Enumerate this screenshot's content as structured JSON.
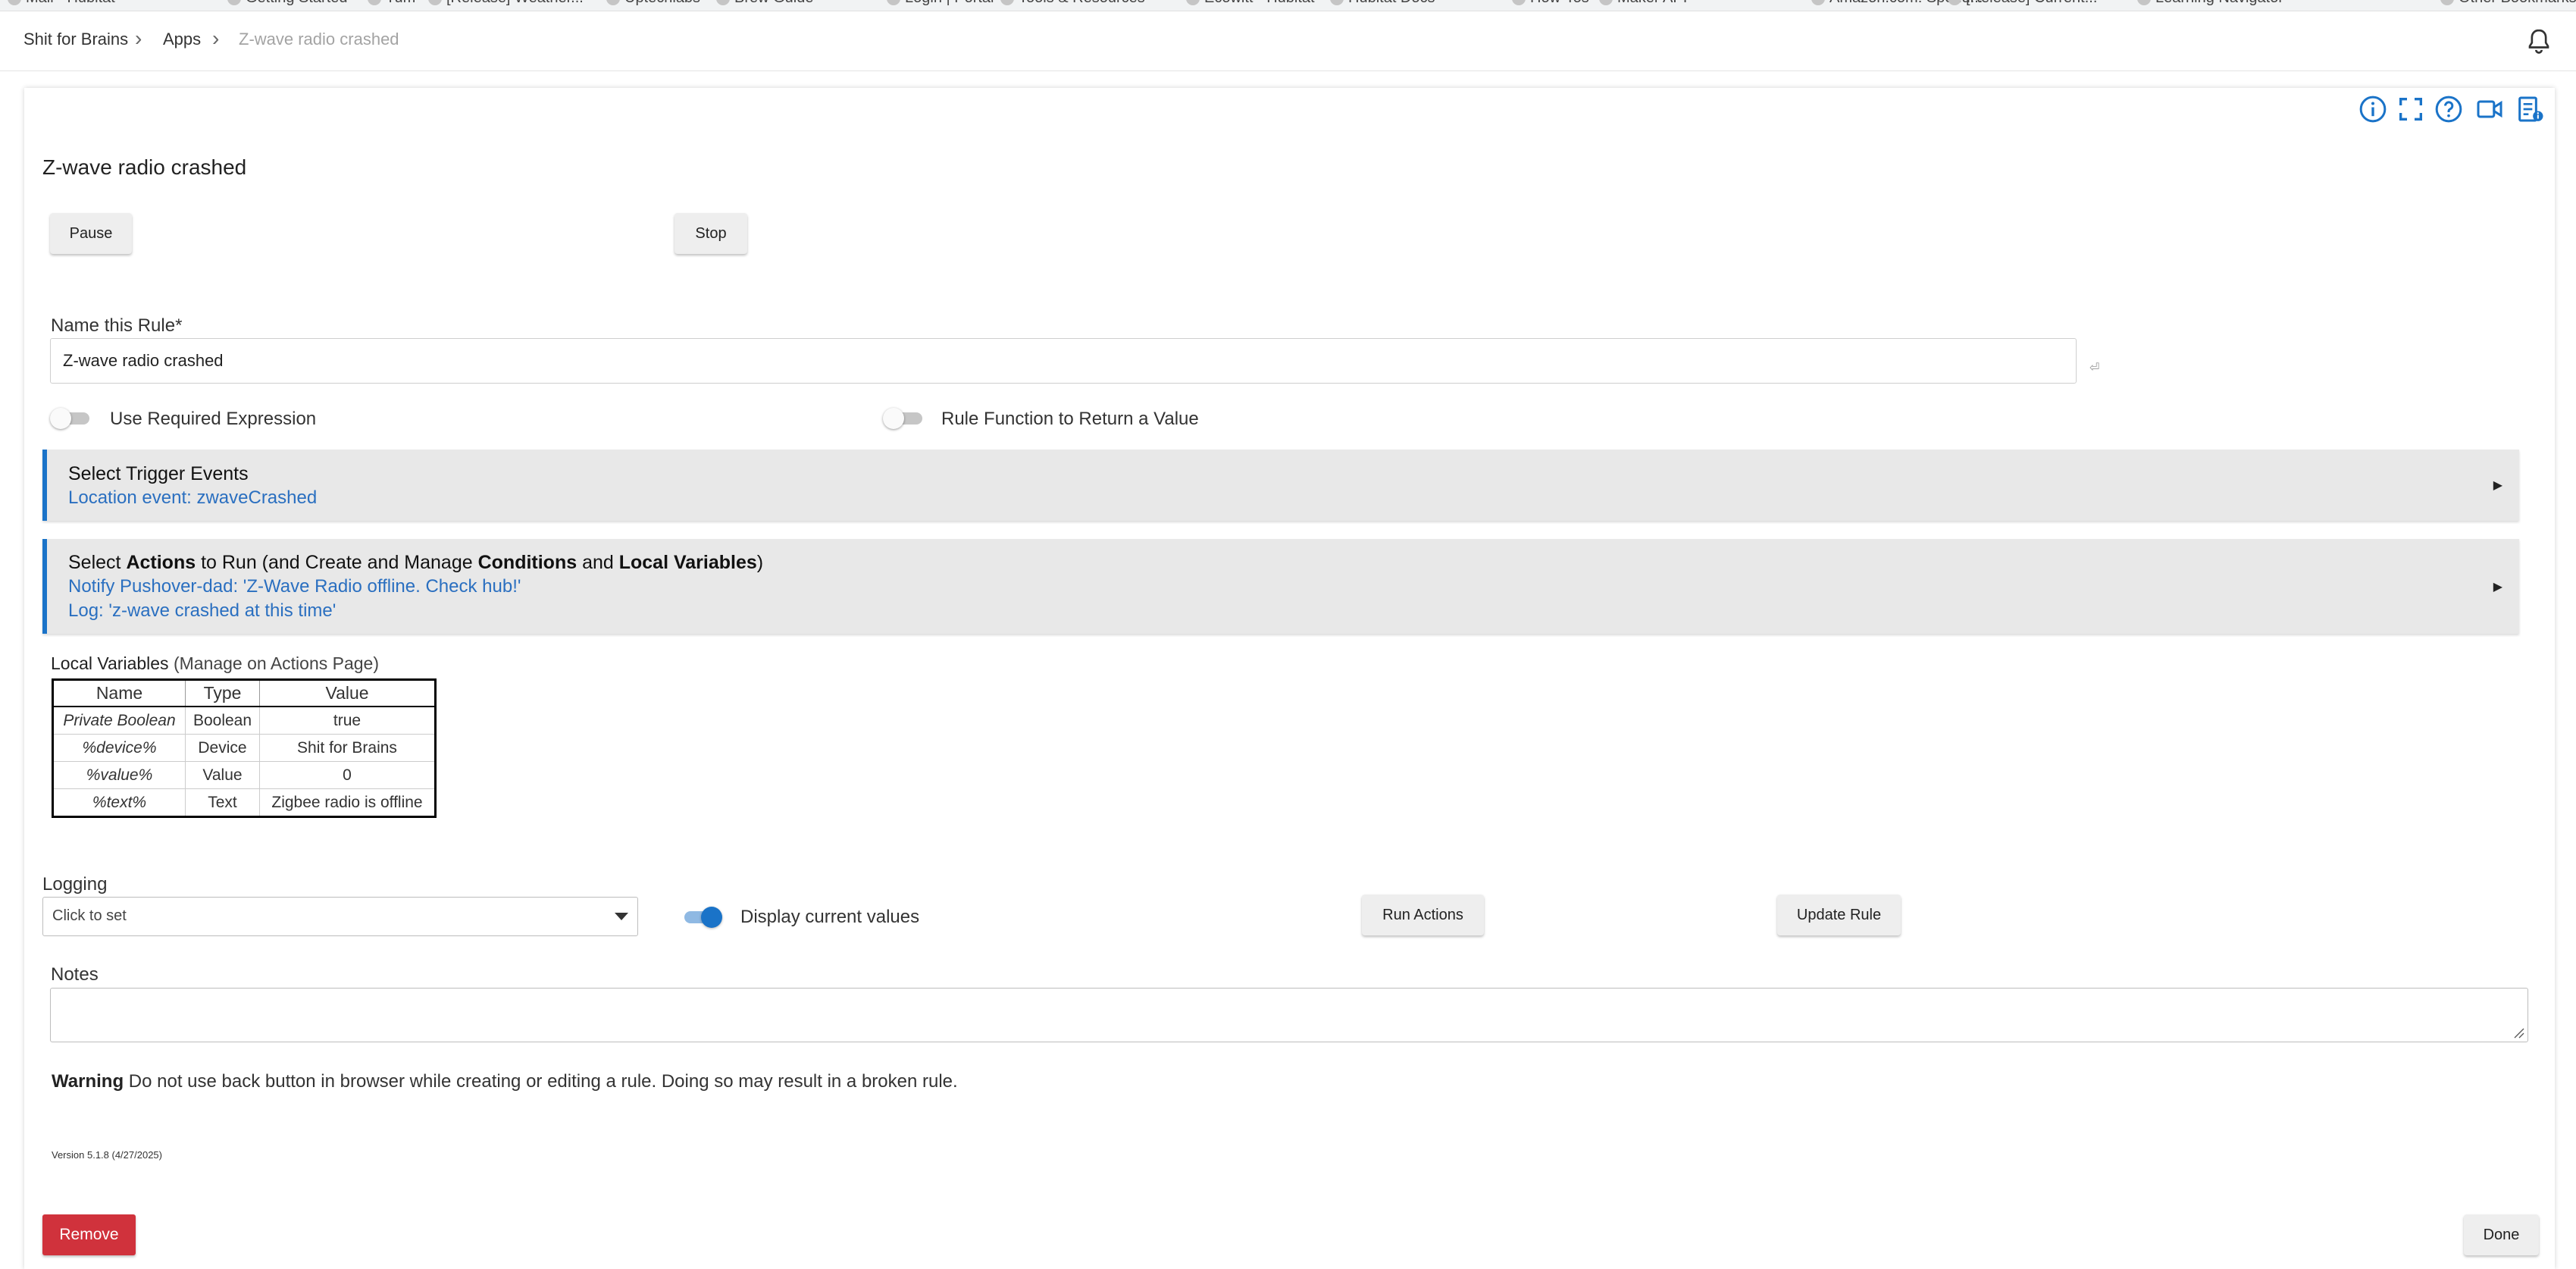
{
  "browser": {
    "bookmarks": [
      "Mail - Hubitat",
      "Getting Started",
      "Tum",
      "[Release] Weather...",
      "Uptechlabs",
      "Brew Guide",
      "Login | Portal",
      "Tools & Resources",
      "Ecowitt - Hubitat",
      "Hubitat Docs",
      "How-Tos",
      "Maker API",
      "Amazon.com: Spend...",
      "[Release] Current...",
      "Learning Navigator",
      "Other Bookmarks"
    ]
  },
  "breadcrumb": {
    "items": [
      "Shit for Brains",
      "Apps",
      "Z-wave radio crashed"
    ]
  },
  "toolbar": {
    "icons": [
      "info-icon",
      "fullscreen-icon",
      "help-icon",
      "video-icon",
      "app-status-icon"
    ]
  },
  "page": {
    "title": "Z-wave radio crashed",
    "pause_label": "Pause",
    "stop_label": "Stop"
  },
  "rule_name": {
    "label": "Name this Rule*",
    "value": "Z-wave radio crashed",
    "edit_glyph": "⏎"
  },
  "toggles": {
    "required_expression": {
      "label": "Use Required Expression",
      "on": false
    },
    "rule_function": {
      "label": "Rule Function to Return a Value",
      "on": false
    },
    "display_values": {
      "label": "Display current values",
      "on": true
    }
  },
  "triggers": {
    "heading": "Select Trigger Events",
    "summary": "Location event: zwaveCrashed",
    "arrow": "▶"
  },
  "actions": {
    "heading_parts": [
      "Select ",
      "Actions",
      " to Run (and Create and Manage ",
      "Conditions",
      " and ",
      "Local Variables",
      ")"
    ],
    "lines": [
      "Notify Pushover-dad: 'Z-Wave Radio offline. Check hub!'",
      "Log: 'z-wave crashed at this time'"
    ],
    "arrow": "▶"
  },
  "local_variables": {
    "title": "Local Variables",
    "subtitle": " (Manage on Actions Page)",
    "headers": [
      "Name",
      "Type",
      "Value"
    ],
    "rows": [
      [
        "Private Boolean",
        "Boolean",
        "true"
      ],
      [
        "%device%",
        "Device",
        "Shit for Brains"
      ],
      [
        "%value%",
        "Value",
        "0"
      ],
      [
        "%text%",
        "Text",
        "Zigbee radio is offline"
      ]
    ]
  },
  "logging": {
    "label": "Logging",
    "value": "Click to set"
  },
  "buttons": {
    "run_actions": "Run Actions",
    "update_rule": "Update Rule",
    "remove": "Remove",
    "done": "Done"
  },
  "notes": {
    "label": "Notes",
    "value": ""
  },
  "warning": {
    "bold": "Warning",
    "text": " Do not use back button in browser while creating or editing a rule. Doing so may result in a broken rule."
  },
  "version": "Version 5.1.8 (4/27/2025)",
  "colors": {
    "accent": "#1a73c8",
    "link_text": "#2a6fc0",
    "danger": "#d0323c",
    "section_bg": "#e8e8e8"
  }
}
